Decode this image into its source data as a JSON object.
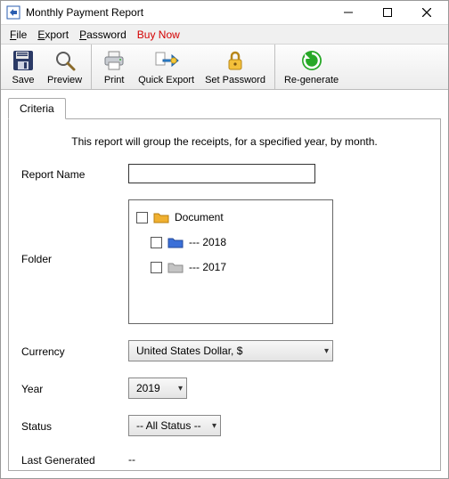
{
  "window": {
    "title": "Monthly Payment Report"
  },
  "menu": {
    "file_pre": "F",
    "file_rest": "ile",
    "export_pre": "E",
    "export_rest": "xport",
    "password_pre": "P",
    "password_rest": "assword",
    "buy": "Buy Now"
  },
  "toolbar": {
    "save": "Save",
    "preview": "Preview",
    "print": "Print",
    "quick_export": "Quick Export",
    "set_password": "Set Password",
    "regenerate": "Re-generate"
  },
  "tabs": {
    "criteria": "Criteria"
  },
  "panel": {
    "description": "This report will group the receipts, for a specified year, by month.",
    "labels": {
      "report_name": "Report Name",
      "folder": "Folder",
      "currency": "Currency",
      "year": "Year",
      "status": "Status",
      "last_generated": "Last Generated"
    },
    "report_name_value": "",
    "folders": [
      {
        "label": "Document",
        "color": "#f0b030"
      },
      {
        "label": "--- 2018",
        "color": "#3a6fd8"
      },
      {
        "label": "--- 2017",
        "color": "#b8b8b8"
      }
    ],
    "currency_value": "United States Dollar, $",
    "year_value": "2019",
    "status_value": "-- All Status --",
    "last_generated_value": "--"
  }
}
